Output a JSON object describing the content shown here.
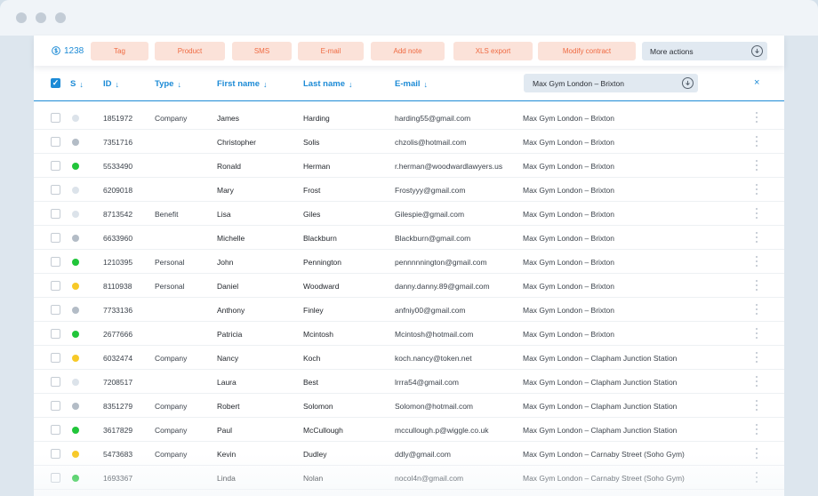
{
  "toolbar": {
    "count": "1238",
    "actions": [
      {
        "label": "Tag"
      },
      {
        "label": "Product"
      },
      {
        "label": "SMS"
      },
      {
        "label": "E-mail"
      },
      {
        "label": "Add note"
      },
      {
        "label": "XLS export"
      },
      {
        "label": "Modify contract"
      }
    ],
    "more_label": "More actions"
  },
  "columns": {
    "status": "S",
    "id": "ID",
    "type": "Type",
    "first_name": "First name",
    "last_name": "Last name",
    "email": "E-mail",
    "location_filter": "Max Gym London – Brixton",
    "close": "×"
  },
  "colors": {
    "accent": "#1d8bd6",
    "action_text": "#ef6a42",
    "action_bg": "#fbe2d9",
    "status_green": "#21c53a",
    "status_yellow": "#f7c928",
    "status_gray": "#b3bcc6",
    "status_light": "#dce3ea"
  },
  "rows": [
    {
      "status": "light",
      "id": "1851972",
      "type": "Company",
      "first": "James",
      "last": "Harding",
      "email": "harding55@gmail.com",
      "location": "Max Gym London – Brixton"
    },
    {
      "status": "gray",
      "id": "7351716",
      "type": "",
      "first": "Christopher",
      "last": "Solis",
      "email": "chzolis@hotmail.com",
      "location": "Max Gym London – Brixton"
    },
    {
      "status": "green",
      "id": "5533490",
      "type": "",
      "first": "Ronald",
      "last": "Herman",
      "email": "r.herman@woodwardlawyers.us",
      "location": "Max Gym London – Brixton"
    },
    {
      "status": "light",
      "id": "6209018",
      "type": "",
      "first": "Mary",
      "last": "Frost",
      "email": "Frostyyy@gmail.com",
      "location": "Max Gym London – Brixton"
    },
    {
      "status": "light",
      "id": "8713542",
      "type": "Benefit",
      "first": "Lisa",
      "last": "Giles",
      "email": "Gilespie@gmail.com",
      "location": "Max Gym London – Brixton"
    },
    {
      "status": "gray",
      "id": "6633960",
      "type": "",
      "first": "Michelle",
      "last": "Blackburn",
      "email": "Blackburn@gmail.com",
      "location": "Max Gym London – Brixton"
    },
    {
      "status": "green",
      "id": "1210395",
      "type": "Personal",
      "first": "John",
      "last": "Pennington",
      "email": "pennnnnington@gmail.com",
      "location": "Max Gym London – Brixton"
    },
    {
      "status": "yellow",
      "id": "8110938",
      "type": "Personal",
      "first": "Daniel",
      "last": "Woodward",
      "email": "danny.danny.89@gmail.com",
      "location": "Max Gym London – Brixton"
    },
    {
      "status": "gray",
      "id": "7733136",
      "type": "",
      "first": "Anthony",
      "last": "Finley",
      "email": "anfniy00@gmail.com",
      "location": "Max Gym London – Brixton"
    },
    {
      "status": "green",
      "id": "2677666",
      "type": "",
      "first": "Patricia",
      "last": "Mcintosh",
      "email": "Mcintosh@hotmail.com",
      "location": "Max Gym London – Brixton"
    },
    {
      "status": "yellow",
      "id": "6032474",
      "type": "Company",
      "first": "Nancy",
      "last": "Koch",
      "email": "koch.nancy@token.net",
      "location": "Max Gym London – Clapham Junction Station"
    },
    {
      "status": "light",
      "id": "7208517",
      "type": "",
      "first": "Laura",
      "last": "Best",
      "email": "lrrra54@gmail.com",
      "location": "Max Gym London – Clapham Junction Station"
    },
    {
      "status": "gray",
      "id": "8351279",
      "type": "Company",
      "first": "Robert",
      "last": "Solomon",
      "email": "Solomon@hotmail.com",
      "location": "Max Gym London – Clapham Junction Station"
    },
    {
      "status": "green",
      "id": "3617829",
      "type": "Company",
      "first": "Paul",
      "last": "McCullough",
      "email": "mccullough.p@wiggle.co.uk",
      "location": "Max Gym London – Clapham Junction Station"
    },
    {
      "status": "yellow",
      "id": "5473683",
      "type": "Company",
      "first": "Kevin",
      "last": "Dudley",
      "email": "ddly@gmail.com",
      "location": "Max Gym London – Carnaby Street (Soho Gym)"
    },
    {
      "status": "green",
      "id": "1693367",
      "type": "",
      "first": "Linda",
      "last": "Nolan",
      "email": "nocol4n@gmail.com",
      "location": "Max Gym London – Carnaby Street (Soho Gym)"
    }
  ]
}
